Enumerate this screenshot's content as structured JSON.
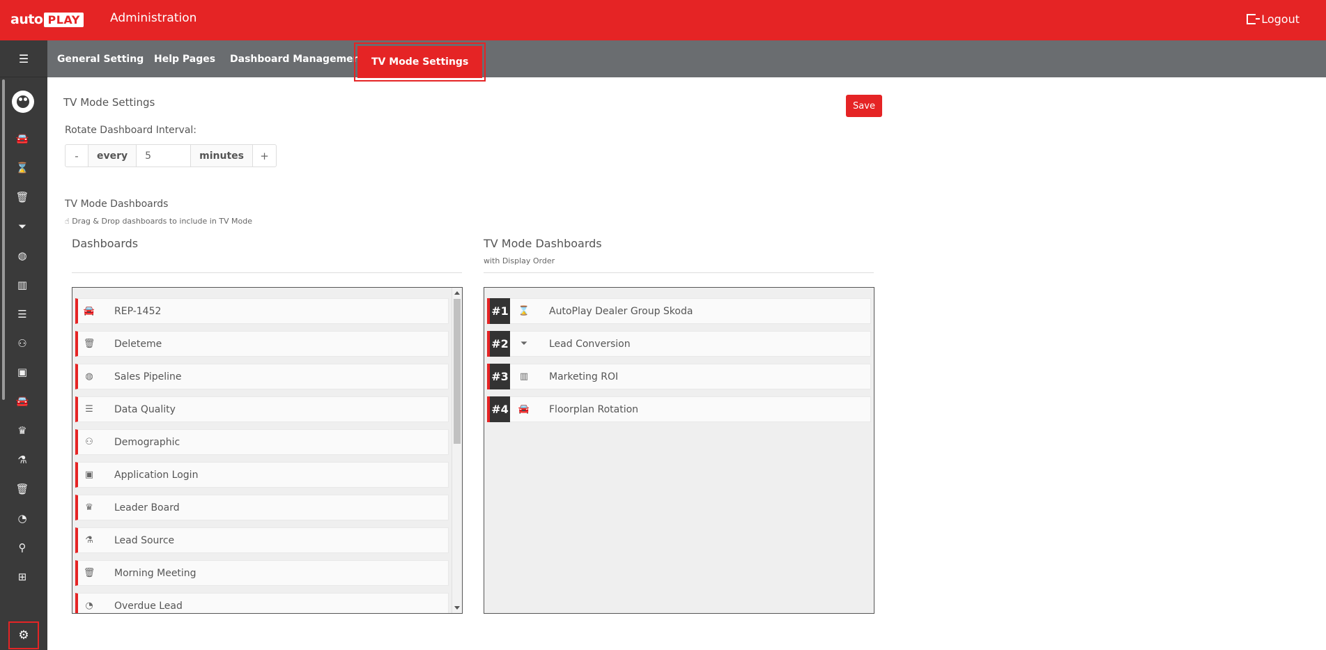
{
  "header": {
    "logo_auto": "auto",
    "logo_play": "PLAY",
    "title": "Administration",
    "logout_label": "Logout"
  },
  "tabs": [
    {
      "label": "General Setting",
      "active": false
    },
    {
      "label": "Help Pages",
      "active": false
    },
    {
      "label": "Dashboard Management",
      "active": false
    },
    {
      "label": "TV Mode Settings",
      "active": true
    }
  ],
  "sidebar": {
    "icons": [
      "car-icon",
      "hourglass-icon",
      "trash-icon",
      "funnel-icon",
      "donut-icon",
      "bar-chart-icon",
      "list-icon",
      "users-icon",
      "window-icon",
      "car-icon",
      "trophy-icon",
      "network-icon",
      "trash-icon",
      "clock-icon",
      "search-icon",
      "gift-icon"
    ],
    "active_icon": "hourglass-icon",
    "settings_icon": "gears-icon"
  },
  "main": {
    "title": "TV Mode Settings",
    "save_label": "Save",
    "interval_label": "Rotate Dashboard Interval:",
    "stepper": {
      "minus": "-",
      "prefix": "every",
      "value": "5",
      "suffix": "minutes",
      "plus": "+"
    },
    "section_title": "TV Mode Dashboards",
    "section_hint": "Drag & Drop dashboards to include in TV Mode"
  },
  "dashboards": {
    "title": "Dashboards",
    "items": [
      {
        "label": "REP-1452",
        "icon": "car-icon"
      },
      {
        "label": "Deleteme",
        "icon": "trash-icon"
      },
      {
        "label": "Sales Pipeline",
        "icon": "donut-icon"
      },
      {
        "label": "Data Quality",
        "icon": "list-icon"
      },
      {
        "label": "Demographic",
        "icon": "users-icon"
      },
      {
        "label": "Application Login",
        "icon": "window-icon"
      },
      {
        "label": "Leader Board",
        "icon": "trophy-icon"
      },
      {
        "label": "Lead Source",
        "icon": "network-icon"
      },
      {
        "label": "Morning Meeting",
        "icon": "trash-icon"
      },
      {
        "label": "Overdue Lead",
        "icon": "clock-icon"
      }
    ]
  },
  "tv_dashboards": {
    "title": "TV Mode Dashboards",
    "subtitle": "with Display Order",
    "items": [
      {
        "order": "#1",
        "label": "AutoPlay Dealer Group Skoda",
        "icon": "hourglass-icon"
      },
      {
        "order": "#2",
        "label": "Lead Conversion",
        "icon": "funnel-icon"
      },
      {
        "order": "#3",
        "label": "Marketing ROI",
        "icon": "bar-chart-icon"
      },
      {
        "order": "#4",
        "label": "Floorplan Rotation",
        "icon": "car-icon"
      }
    ]
  },
  "colors": {
    "brand": "#e52425",
    "sidebar": "#3a3a3a",
    "tabsbar": "#6a6d70"
  }
}
